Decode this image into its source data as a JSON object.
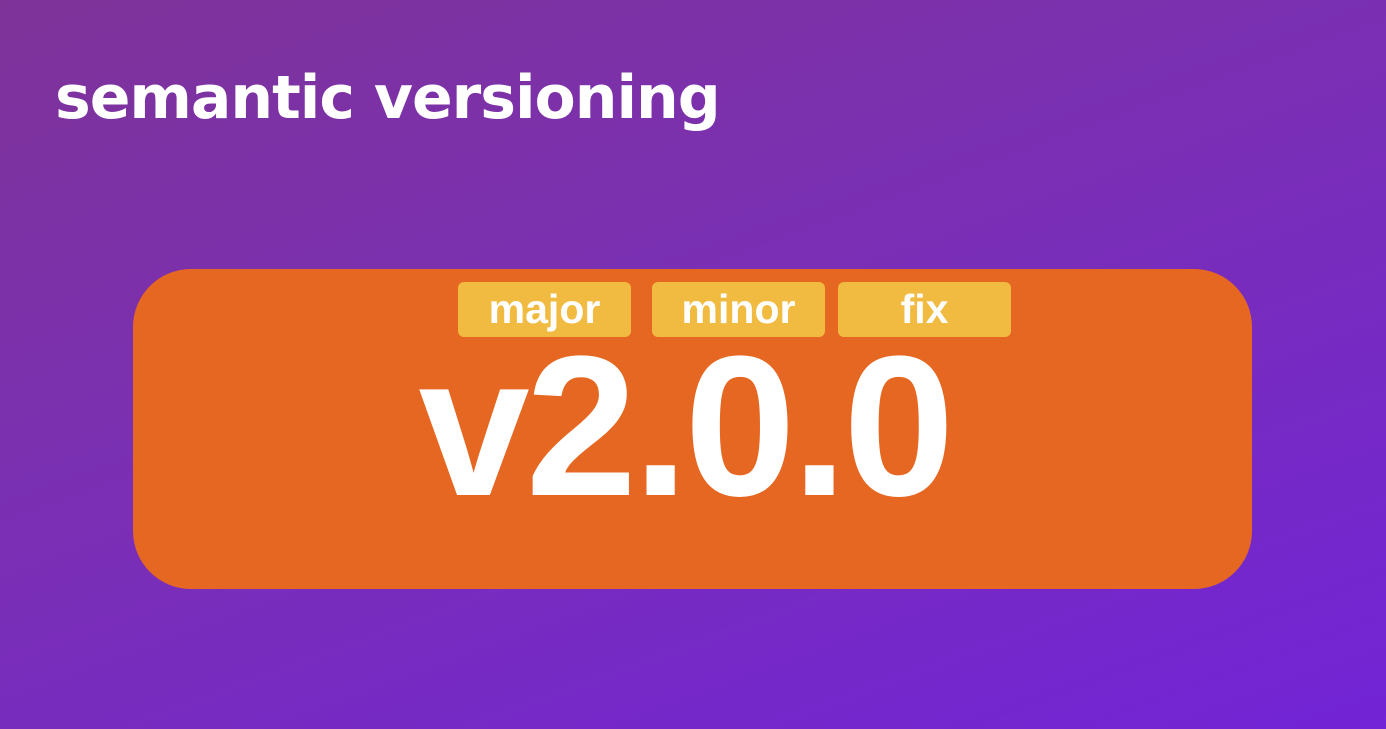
{
  "slide": {
    "title": "semantic versioning"
  },
  "version_card": {
    "labels": {
      "major": "major",
      "minor": "minor",
      "fix": "fix"
    },
    "version": "v2.0.0"
  },
  "colors": {
    "background_start": "#7e3399",
    "background_end": "#7224d6",
    "card": "#e56721",
    "tag": "#f0bb40",
    "text": "#ffffff"
  }
}
